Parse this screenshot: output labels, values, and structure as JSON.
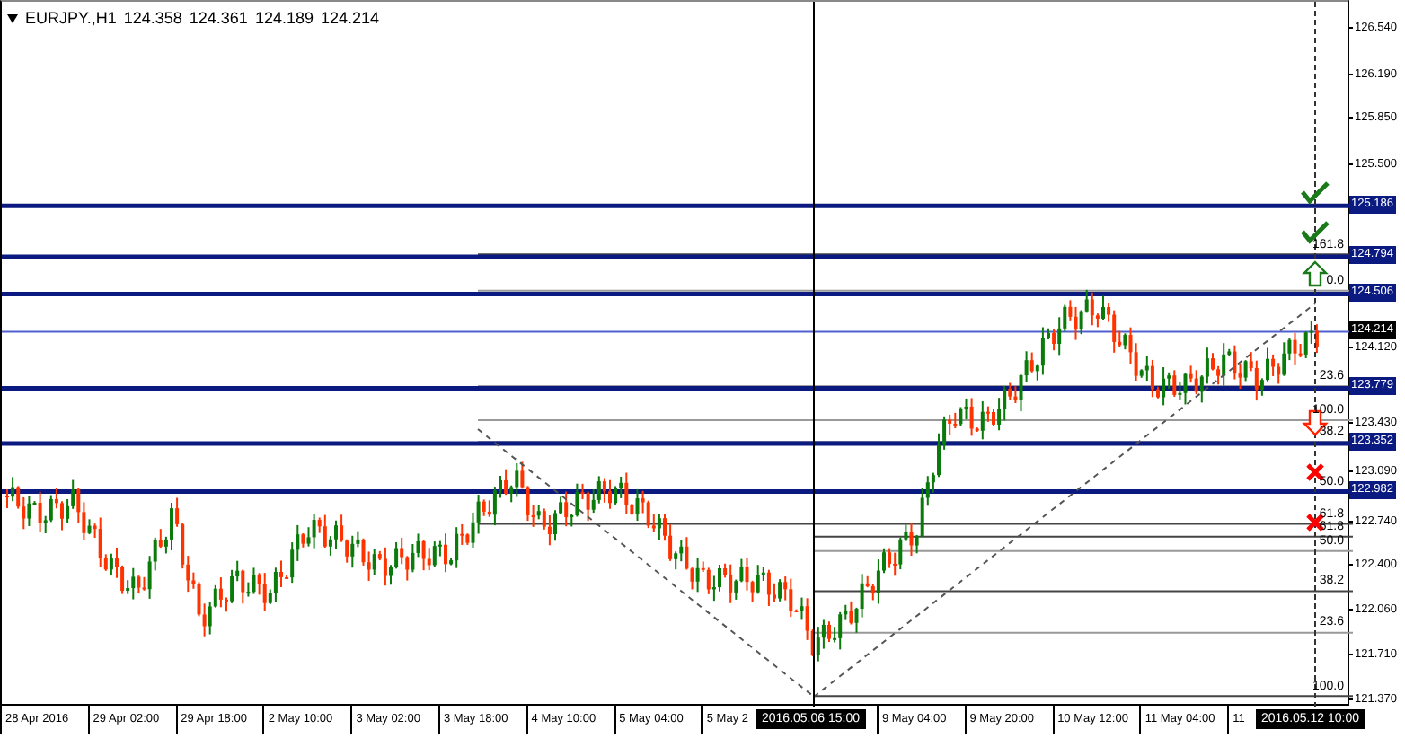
{
  "header": {
    "symbol": "EURJPY.,H1",
    "prices": [
      "124.358",
      "124.361",
      "124.189",
      "124.214"
    ]
  },
  "price_axis": {
    "ticks": [
      "126.540",
      "126.190",
      "125.850",
      "125.500",
      "124.120",
      "123.430",
      "123.090",
      "122.740",
      "122.400",
      "122.060",
      "121.710",
      "121.370"
    ]
  },
  "levels": [
    {
      "price": "125.186",
      "kind": "line"
    },
    {
      "price": "124.794",
      "kind": "line"
    },
    {
      "price": "124.506",
      "kind": "line"
    },
    {
      "price": "124.214",
      "kind": "bid"
    },
    {
      "price": "123.779",
      "kind": "line"
    },
    {
      "price": "123.352",
      "kind": "line"
    },
    {
      "price": "122.982",
      "kind": "line"
    }
  ],
  "fibo_sets": [
    {
      "labels": [
        "161.8",
        "0.0",
        "23.6",
        "100.0",
        "38.2",
        "50.0",
        "61.8"
      ]
    },
    {
      "labels": [
        "61.8",
        "50.0",
        "38.2",
        "23.6",
        "100.0"
      ]
    }
  ],
  "time_axis": {
    "labels": [
      "28 Apr 2016",
      "29 Apr 02:00",
      "29 Apr 18:00",
      "2 May 10:00",
      "3 May 02:00",
      "3 May 18:00",
      "4 May 10:00",
      "5 May 04:00",
      "5 May 2",
      "9 May 04:00",
      "9 May 20:00",
      "10 May 12:00",
      "11 May 04:00",
      "11"
    ],
    "cursor_labels": [
      "2016.05.06 15:00",
      "2016.05.12 10:00"
    ]
  }
}
